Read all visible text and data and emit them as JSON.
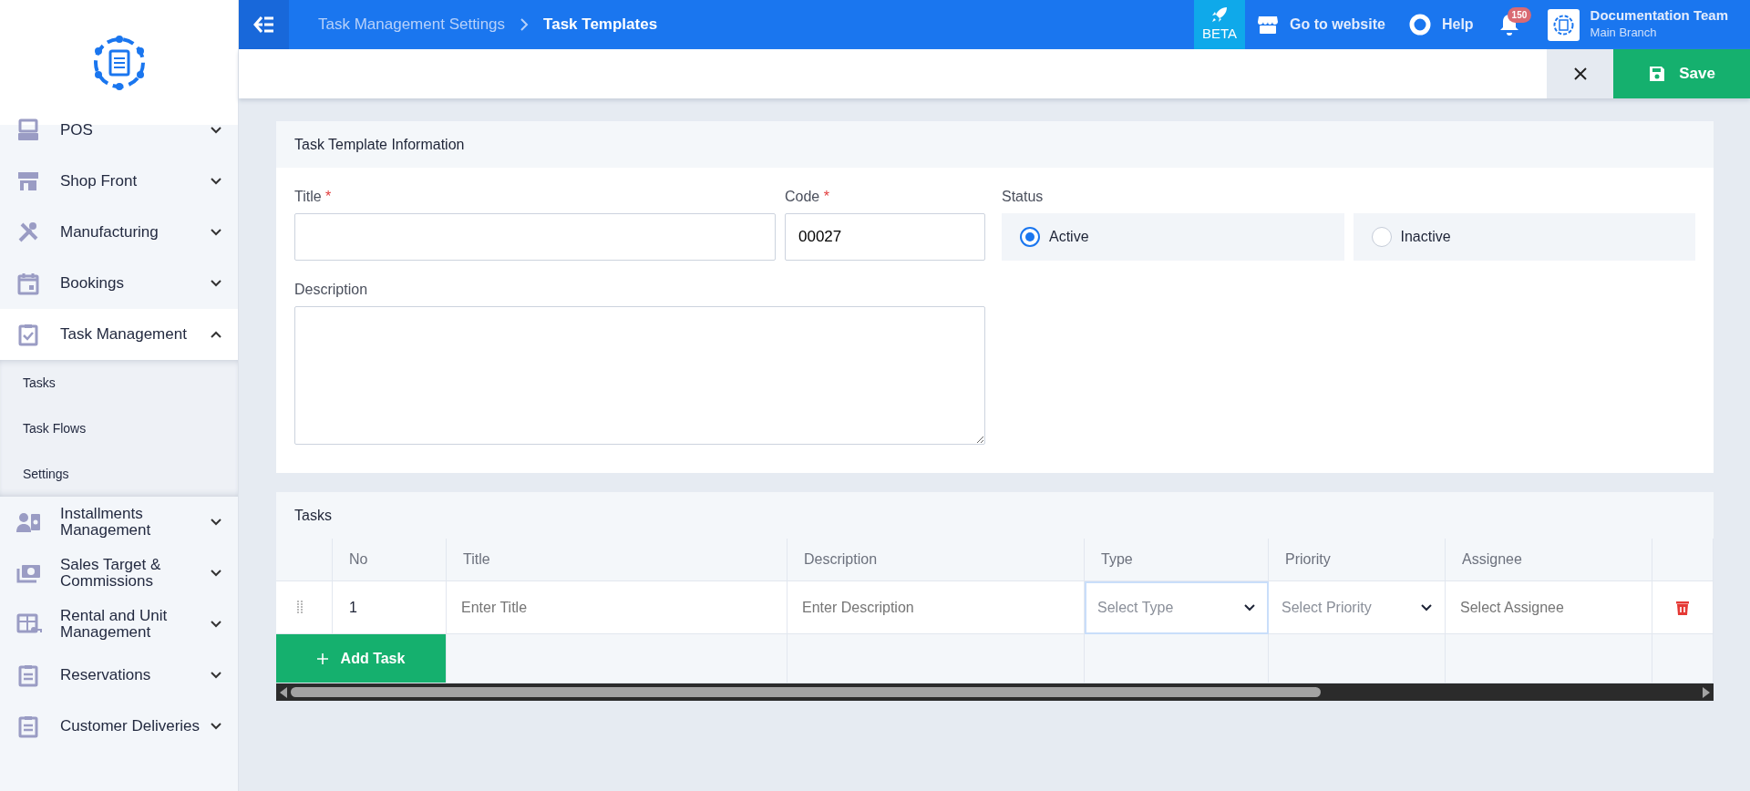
{
  "sidebar": {
    "items": [
      {
        "label": "POS",
        "expanded": false
      },
      {
        "label": "Shop Front",
        "expanded": false
      },
      {
        "label": "Manufacturing",
        "expanded": false
      },
      {
        "label": "Bookings",
        "expanded": false
      },
      {
        "label": "Task Management",
        "expanded": true,
        "children": [
          {
            "label": "Tasks"
          },
          {
            "label": "Task Flows"
          },
          {
            "label": "Settings"
          }
        ]
      },
      {
        "label": "Installments Management",
        "expanded": false
      },
      {
        "label": "Sales Target & Commissions",
        "expanded": false
      },
      {
        "label": "Rental and Unit Management",
        "expanded": false
      },
      {
        "label": "Reservations",
        "expanded": false
      },
      {
        "label": "Customer Deliveries",
        "expanded": false
      }
    ]
  },
  "topbar": {
    "breadcrumb": [
      "Task Management Settings",
      "Task Templates"
    ],
    "beta": "BETA",
    "website": "Go to website",
    "help": "Help",
    "notifications": "150",
    "user": {
      "name": "Documentation Team",
      "branch": "Main Branch"
    }
  },
  "actions": {
    "save": "Save"
  },
  "info_card": {
    "title": "Task Template Information",
    "fields": {
      "title": {
        "label": "Title",
        "required_mark": "*"
      },
      "code": {
        "label": "Code",
        "required_mark": "*",
        "value": "00027"
      },
      "description": {
        "label": "Description"
      }
    },
    "status": {
      "label": "Status",
      "options": [
        {
          "label": "Active",
          "selected": true
        },
        {
          "label": "Inactive",
          "selected": false
        }
      ]
    }
  },
  "tasks_card": {
    "title": "Tasks",
    "table": {
      "columns": [
        "No",
        "Title",
        "Description",
        "Type",
        "Priority",
        "Assignee"
      ],
      "rows": [
        {
          "no": "1",
          "title_placeholder": "Enter Title",
          "description_placeholder": "Enter Description",
          "type_placeholder": "Select Type",
          "priority_placeholder": "Select Priority",
          "assignee_placeholder": "Select Assignee"
        }
      ]
    },
    "add_button": "Add Task"
  }
}
